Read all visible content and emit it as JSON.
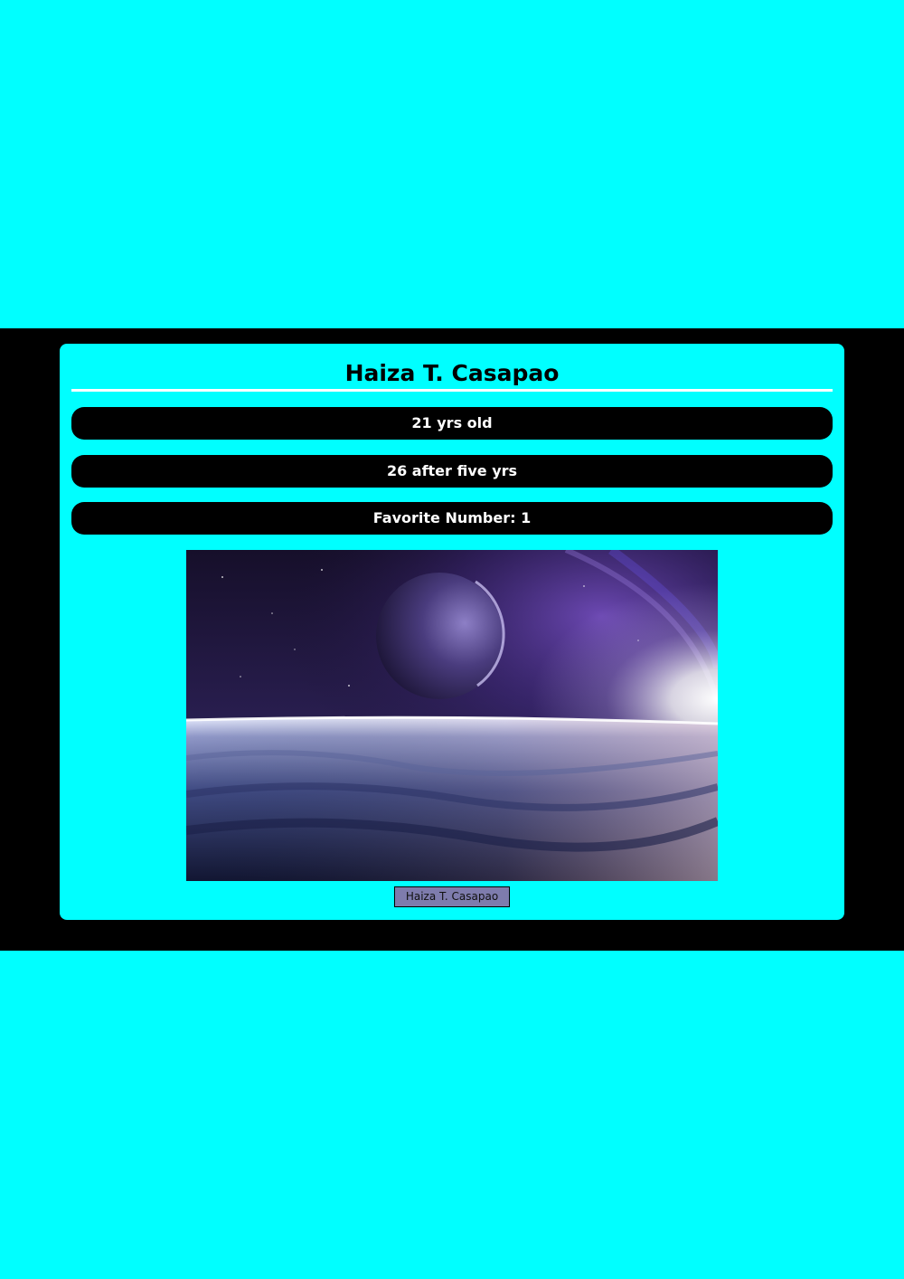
{
  "profile": {
    "name": "Haiza T. Casapao",
    "age": "21 yrs old",
    "future_age": "26 after five yrs",
    "favorite_number": "Favorite Number: 1",
    "button_label": "Haiza T. Casapao"
  },
  "image": {
    "subject": "space scene with planet over horizon"
  },
  "colors": {
    "page_background": "#00ffff",
    "band_background": "#000000",
    "pill_background": "#000000",
    "pill_text": "#ffffff",
    "button_background": "#7e7cad"
  }
}
